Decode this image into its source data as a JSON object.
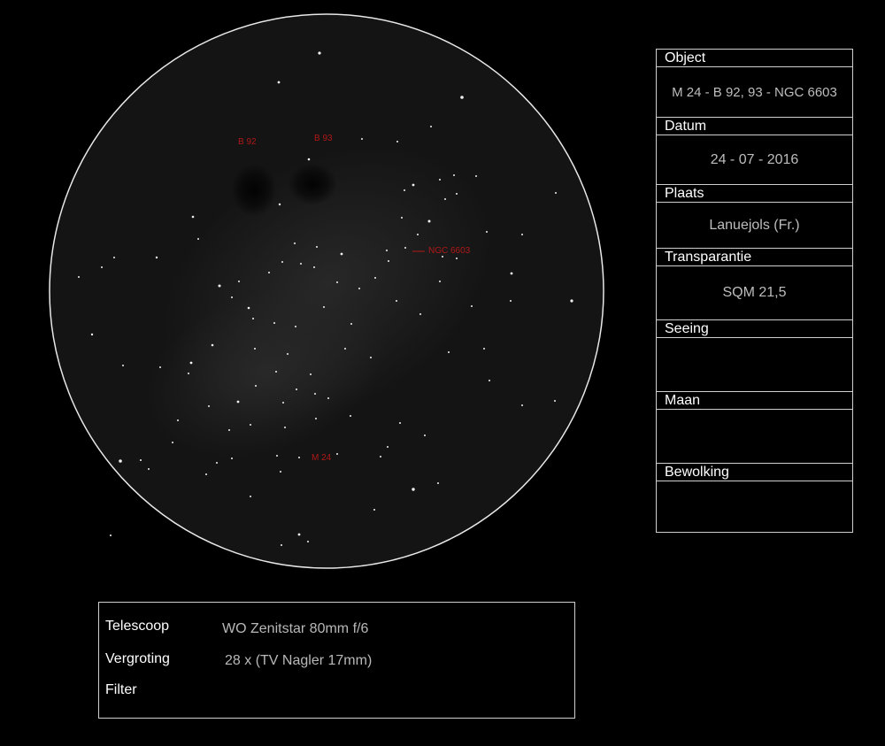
{
  "labels": {
    "b92": "B 92",
    "b93": "B 93",
    "ngc": "NGC 6603",
    "m24": "M 24"
  },
  "info": {
    "object_label": "Object",
    "object_value": "M 24 - B 92, 93 - NGC 6603",
    "date_label": "Datum",
    "date_value": "24 - 07 - 2016",
    "place_label": "Plaats",
    "place_value": "Lanuejols (Fr.)",
    "transparency_label": "Transparantie",
    "transparency_value": "SQM 21,5",
    "seeing_label": "Seeing",
    "seeing_value": "",
    "moon_label": "Maan",
    "moon_value": "",
    "clouds_label": "Bewolking",
    "clouds_value": ""
  },
  "equipment": {
    "telescope_label": "Telescoop",
    "telescope_value": "WO Zenitstar 80mm f/6",
    "magnification_label": "Vergroting",
    "magnification_value": "28 x (TV Nagler 17mm)",
    "filter_label": "Filter",
    "filter_value": ""
  },
  "colors": {
    "background": "#000000",
    "field": "#141414",
    "annotation": "#b01818",
    "border": "#cfcfcf"
  }
}
